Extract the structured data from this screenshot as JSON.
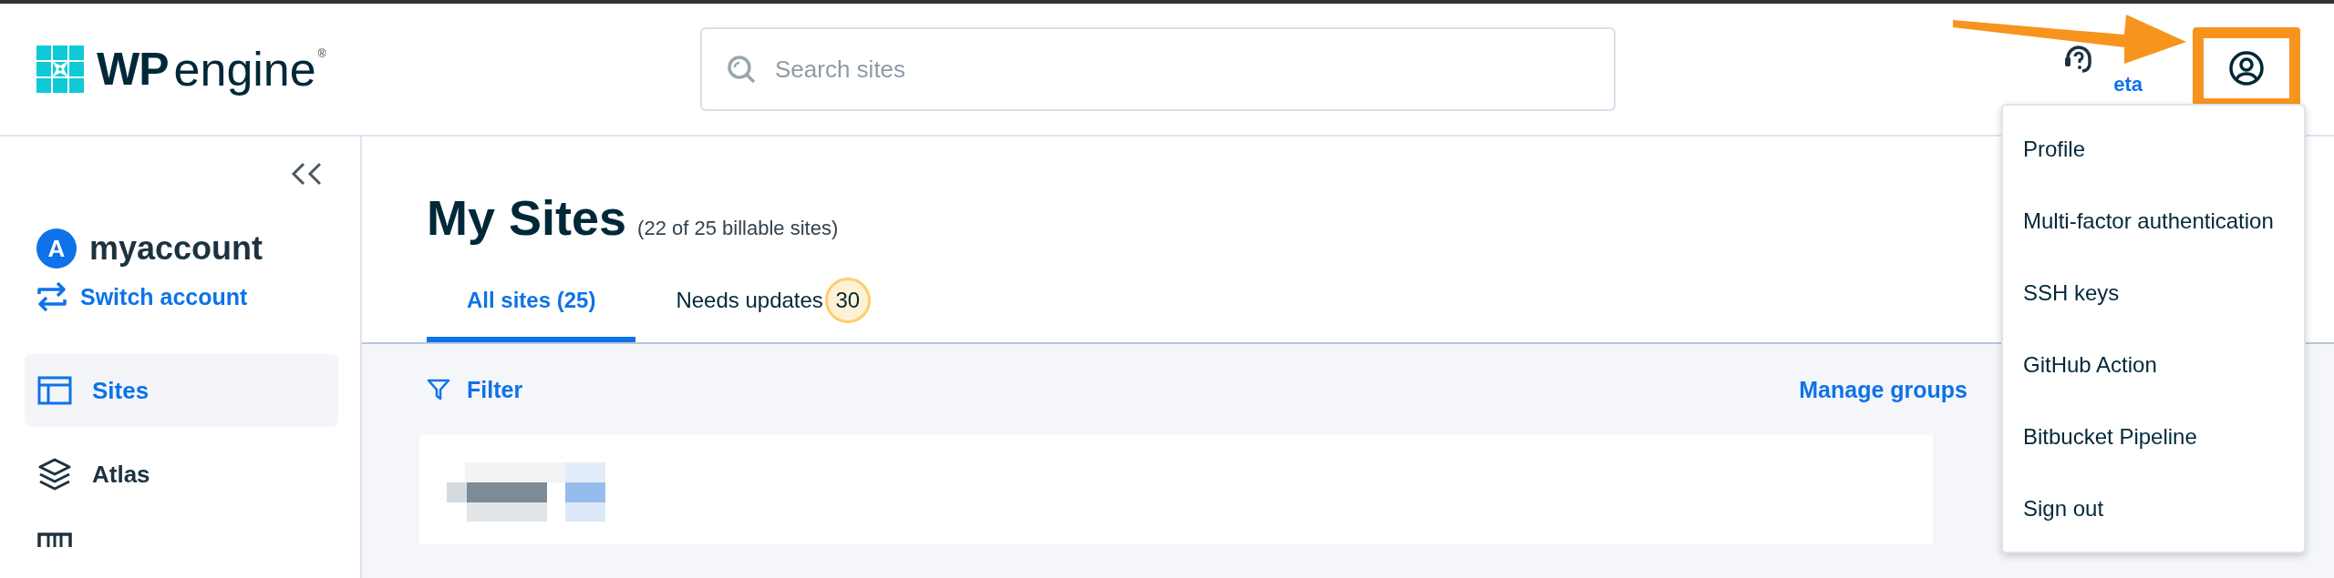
{
  "header": {
    "logo": {
      "mark": "WP",
      "word": "engine",
      "registered": "®"
    },
    "search": {
      "placeholder": "Search sites"
    },
    "help": {
      "label": "eta"
    }
  },
  "profile_menu": {
    "open": true,
    "items": [
      {
        "label": "Profile"
      },
      {
        "label": "Multi-factor authentication"
      },
      {
        "label": "SSH keys"
      },
      {
        "label": "GitHub Action"
      },
      {
        "label": "Bitbucket Pipeline"
      },
      {
        "label": "Sign out"
      }
    ]
  },
  "sidebar": {
    "account": {
      "initial": "A",
      "name": "myaccount"
    },
    "switch_account": "Switch account",
    "items": [
      {
        "label": "Sites",
        "selected": true
      },
      {
        "label": "Atlas",
        "selected": false
      }
    ]
  },
  "main": {
    "title": "My Sites",
    "subtitle": "(22 of 25 billable sites)",
    "tabs": [
      {
        "label": "All sites (25)",
        "selected": true
      },
      {
        "label": "Needs updates",
        "badge": "30",
        "selected": false
      }
    ],
    "filter": "Filter",
    "manage_groups": "Manage groups"
  }
}
